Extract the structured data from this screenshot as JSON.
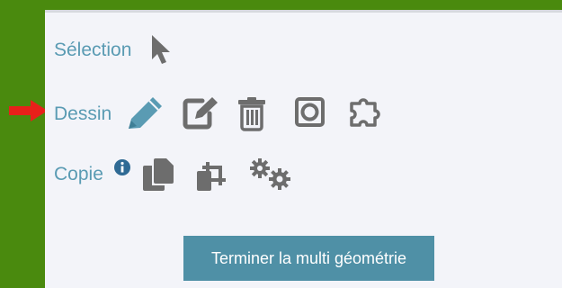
{
  "toolbar": {
    "selection": {
      "label": "Sélection",
      "icon": "cursor-arrow-icon"
    },
    "drawing": {
      "label": "Dessin",
      "icons": [
        "pencil-icon",
        "edit-square-icon",
        "trash-icon",
        "circle-in-square-icon",
        "puzzle-piece-icon"
      ]
    },
    "copy": {
      "label": "Copie",
      "info_icon": "info-circle-icon",
      "icons": [
        "copy-pages-icon",
        "crop-copy-icon",
        "gears-icon"
      ]
    }
  },
  "finish_button_label": "Terminer la multi géométrie",
  "indicator": {
    "icon": "red-arrow-icon",
    "color": "#e8201a"
  },
  "colors": {
    "background_green": "#4a8a0e",
    "panel": "#f3f4f9",
    "label_blue": "#5a9bb3",
    "icon_gray": "#6d6d6d",
    "pencil_blue": "#5a9bb3",
    "button_blue": "#4f90a6",
    "button_text": "#ffffff"
  }
}
